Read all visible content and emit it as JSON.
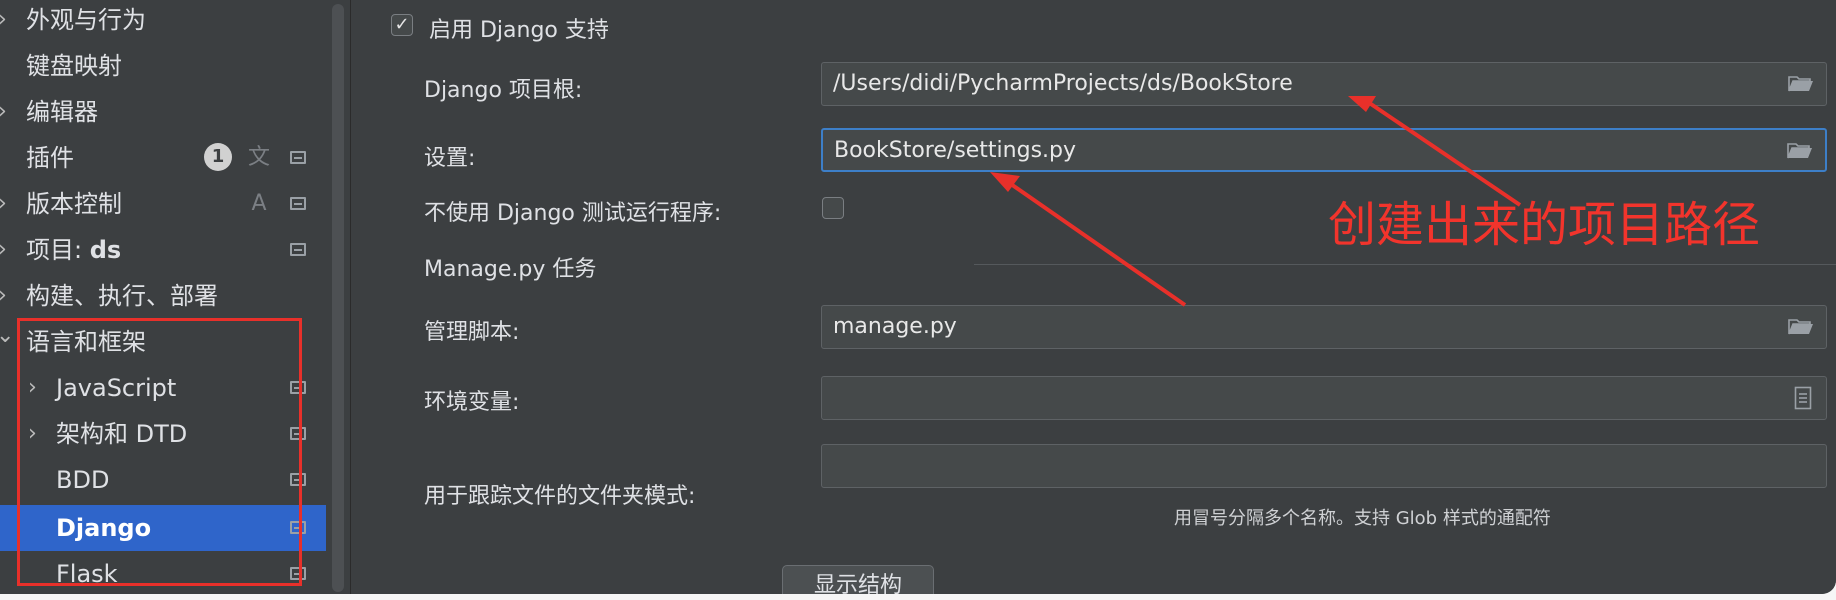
{
  "sidebar": {
    "items": [
      {
        "label": "外观与行为",
        "chevron": "›"
      },
      {
        "label": "键盘映射"
      },
      {
        "label": "编辑器",
        "chevron": "›"
      },
      {
        "label": "插件",
        "badge": "1",
        "translate_icon": "文A"
      },
      {
        "label": "版本控制",
        "chevron": "›"
      },
      {
        "label_prefix": "项目: ",
        "label_bold": "ds",
        "chevron": "›"
      },
      {
        "label": "构建、执行、部署",
        "chevron": "›"
      },
      {
        "label": "语言和框架",
        "chevron": "⌄"
      },
      {
        "label": "JavaScript",
        "chevron": "›"
      },
      {
        "label": "架构和 DTD",
        "chevron": "›"
      },
      {
        "label": "BDD"
      },
      {
        "label": "Django",
        "selected": true
      },
      {
        "label": "Flask"
      }
    ]
  },
  "main": {
    "enable_checkbox": {
      "label": "启用 Django 支持",
      "checked": true,
      "mark": "✓"
    },
    "project_root": {
      "label": "Django 项目根:",
      "value": "/Users/didi/PycharmProjects/ds/BookStore"
    },
    "settings": {
      "label": "设置:",
      "value": "BookStore/settings.py"
    },
    "no_test_runner": {
      "label": "不使用 Django 测试运行程序:",
      "checked": false
    },
    "section_title": "Manage.py 任务",
    "manage_script": {
      "label": "管理脚本:",
      "value": "manage.py"
    },
    "env_vars": {
      "label": "环境变量:",
      "value": ""
    },
    "folder_pattern": {
      "label": "用于跟踪文件的文件夹模式:",
      "value": "",
      "hint": "用冒号分隔多个名称。支持 Glob 样式的通配符"
    },
    "show_structure_button": "显示结构"
  },
  "annotation": {
    "text": "创建出来的项目路径",
    "color": "#f2342c"
  },
  "colors": {
    "background": "#3c3f41",
    "selection": "#2f65ca",
    "focus_border": "#3d7fc8",
    "annotation_red": "#e8302a"
  }
}
